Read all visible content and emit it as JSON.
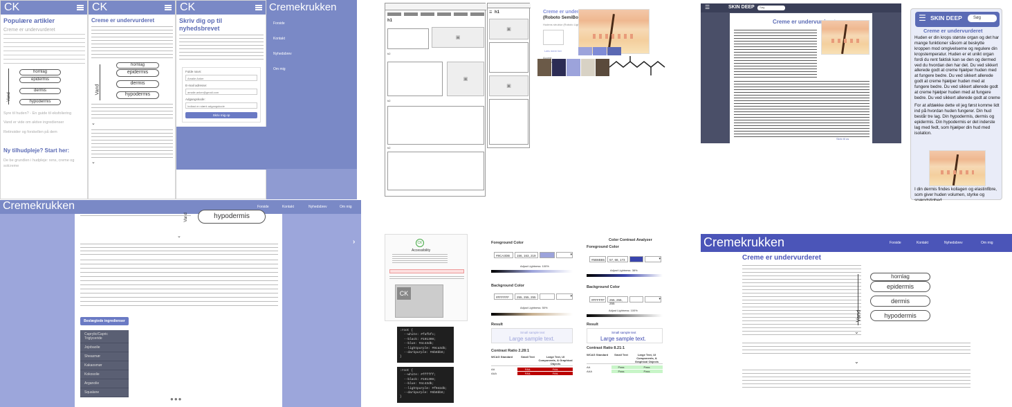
{
  "phone_popular": {
    "logo": "CK",
    "heading": "Populære artikler",
    "article_title": "Creme er undervurderet",
    "layers": [
      "hornlag",
      "epidermis",
      "dermis",
      "hypodermis"
    ],
    "water_label": "Vand",
    "links": [
      "Syre til huden? - En guide til eksfoliering",
      "Vand er vide om aktive ingredienser",
      "Retinoider og forskellen på dem"
    ],
    "cta": "Ny tilhudpleje? Start her:",
    "cta_sub": "De be grundlen i hudpleje: rens, creme og solcreme"
  },
  "phone_article": {
    "logo": "CK",
    "title": "Creme er undervurderet",
    "layers": [
      "hornlag",
      "epidermis",
      "dermis",
      "hypodermis"
    ],
    "water_label": "Vand"
  },
  "phone_newsletter": {
    "logo": "CK",
    "title": "Skriv dig op til nyhedsbrevet",
    "fields": [
      {
        "label": "Fulde navn:",
        "value": "Amalie Anker"
      },
      {
        "label": "E-mail adresse:",
        "value": "amalie.anker@gmail.com"
      },
      {
        "label": "Adgangskode:",
        "value": "Indtast en stærk adgangskode"
      }
    ],
    "button": "Skriv mig op"
  },
  "phone_menu": {
    "logo": "Cremekrukken",
    "items": [
      "Forside",
      "Kontakt",
      "Nyhedsbrev",
      "Om mig"
    ]
  },
  "desktop_bottom": {
    "logo": "Cremekrukken",
    "nav": [
      "Forside",
      "Kontakt",
      "Nyhedsbrev",
      "Om mig"
    ],
    "layer": "hypodermis",
    "water_label": "Vand",
    "related_button": "Beslægtede ingredienser",
    "ingredients": [
      "Caprylic/Capric Triglyceride",
      "Jojobaolie",
      "Sheasmør",
      "Kakaosmør",
      "Kokosolie",
      "Arganolie",
      "Squalane"
    ]
  },
  "wireframe": {
    "h1": "h1",
    "labels": [
      "h2",
      "h2",
      "h2",
      "h2"
    ]
  },
  "style_tile": {
    "title": "Creme er undervurderet",
    "subtitle": "(Roboto SemiBold #9CA3DB)",
    "body_label": "Hudens struktur (Roboto Light #6F1C8F)",
    "swatch_labels": [
      "Accent",
      "Baggrund",
      "Tekst"
    ],
    "palette": [
      {
        "name": "#9CA3DB",
        "color": "#9ca3db"
      },
      {
        "name": "#7F8BD6",
        "color": "#7f8bd6"
      },
      {
        "name": "#5A68B3",
        "color": "#5a68b3"
      },
      {
        "name": "#2C2C54",
        "color": "#2c2c54"
      },
      {
        "name": "#EEEAF0",
        "color": "#eeeaf0"
      },
      {
        "name": "#1F1F1F",
        "color": "#1f1f1f"
      }
    ],
    "link": "Læs mere her"
  },
  "skin_deep_desktop": {
    "logo": "SKIN DEEP",
    "search": "Søg",
    "title": "Creme er undervurderet",
    "link": "Skriv til os"
  },
  "skin_deep_mobile": {
    "logo": "SKIN DEEP",
    "search": "Søg",
    "title": "Creme er undervurderet",
    "p1": "Huden er din krops største organ og det har mange funktioner såsom at beskytte kroppen mod omgivelserne og regulere din kropstemperatur. Huden er et unikt organ fordi du rent faktisk kan se den og dermed ved du hvordan den har det. Du ved sikkert allerede godt at creme hjælper huden med at fungere bedre. Du ved sikkert allerede godt at creme hjælper huden med at fungere bedre. Du ved sikkert allerede godt at creme hjælper huden med at fungere bedre. Du ved sikkert allerede godt at creme hjælper huden med at fungere bedre.",
    "p2": "For at afdække dette vil jeg først komme lidt ind på hvordan huden fungerer. Din hud består tre lag. Din hypodermis, dermis og epidermis. Din hypodermis er det inderste lag med fedt, som hjælper din hud med isolation.",
    "p3": "I din dermis findes kollagen og elastinfibre, som giver huden volumen, styrke og spændstighed."
  },
  "contrast_left": {
    "title": "Accessibility",
    "fg_label": "Foreground Color",
    "fg_hex": "#9CA3DB",
    "fg_rgb": "156, 163, 219",
    "bg_label": "Background Color",
    "bg_hex": "#FFFFFF",
    "bg_rgb": "255, 255, 255",
    "lightness_fg": "Adjust Lightness: 100%",
    "lightness_bg": "Adjust Lightness: 50%",
    "result": "Result",
    "small": "Small sample text",
    "large": "Large sample text.",
    "ratio": "Contrast Ratio 2.28:1",
    "table_head": [
      "WCAG Standard",
      "Small Text",
      "Large Text, UI Components, & Graphical Objects"
    ],
    "rows": [
      [
        "AA",
        "FAIL",
        "FAIL"
      ],
      [
        "AAA",
        "FAIL",
        "FAIL"
      ]
    ],
    "code1": [
      ":root {",
      "--white: #fafbfc;",
      "--black: #191308;",
      "--blue: #4c43db;",
      "--lightpurple: #9ca3db;",
      "--darkpurple: #6b6bb6;",
      "}"
    ],
    "code2": [
      ":root {",
      "--white: #ffffff;",
      "--black: #191308;",
      "--blue: #4c43db;",
      "--lightpurple: #f942db;",
      "--darkpurple: #6b6bb6;",
      "}"
    ]
  },
  "contrast_right": {
    "title": "Color Contrast Analyzer",
    "fg_label": "Foreground Color",
    "fg_hex": "#5B6BB5",
    "fg_rgb": "57, 68, 173",
    "bg_label": "Background Color",
    "bg_hex": "#FFFFFF",
    "bg_rgb": "255, 255, 255",
    "lightness_fg": "Adjust Lightness: 38%",
    "lightness_bg": "Adjust Lightness: 100%",
    "result": "Result",
    "small": "Small sample text",
    "large": "Large sample text.",
    "ratio": "Contrast Ratio 8.21:1",
    "table_head": [
      "WCAG Standard",
      "Small Text",
      "Large Text, UI Components, & Graphical Objects"
    ],
    "rows": [
      [
        "AA",
        "Pass",
        "Pass"
      ],
      [
        "AAA",
        "Pass",
        "Pass"
      ]
    ]
  },
  "desktop_final": {
    "logo": "Cremekrukken",
    "nav": [
      "Forside",
      "Kontakt",
      "Nyhedsbrev",
      "Om mig"
    ],
    "title": "Creme er undervurderet",
    "layers": [
      "hornlag",
      "epidermis",
      "dermis",
      "hypodermis"
    ],
    "water_label": "Vand"
  }
}
